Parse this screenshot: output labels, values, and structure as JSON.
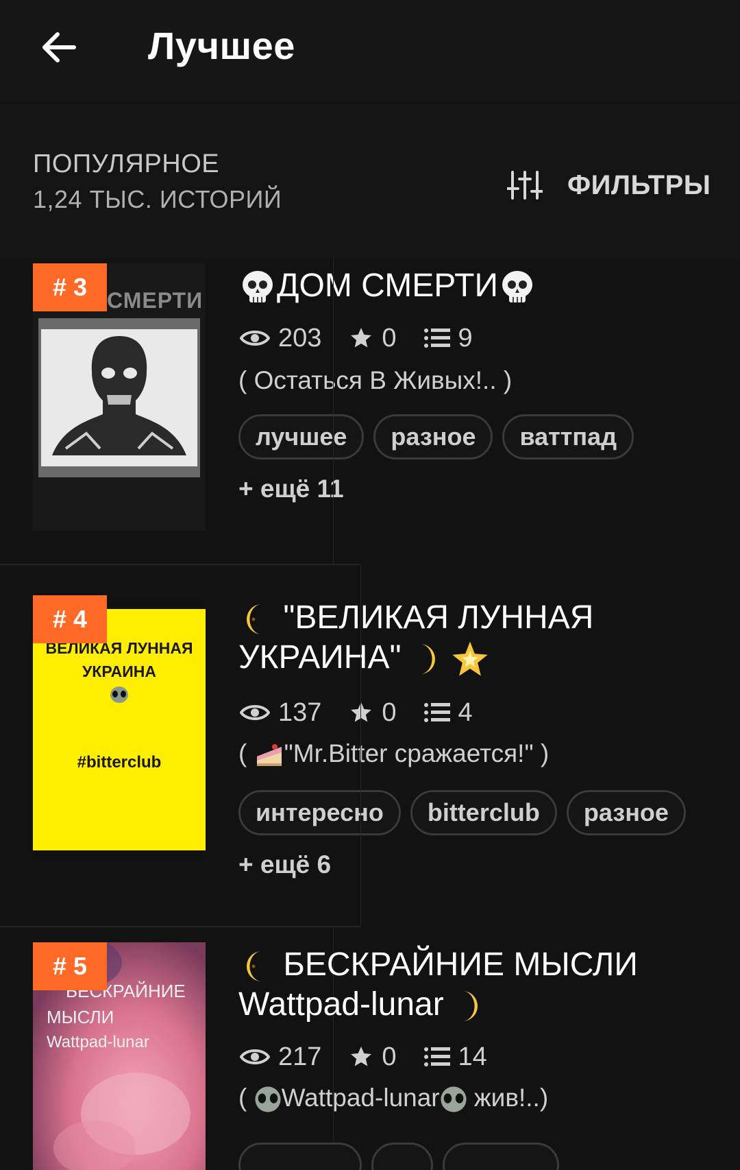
{
  "header": {
    "title": "Лучшее",
    "back_icon": "arrow-left-icon"
  },
  "section": {
    "title": "ПОПУЛЯРНОЕ",
    "count": "1,24 ТЫС. ИСТОРИЙ",
    "filters_label": "ФИЛЬТРЫ",
    "filters_icon": "sliders-icon"
  },
  "stories": [
    {
      "rank": "# 3",
      "title": "ДОМ СМЕРТИ",
      "title_emoji": "skull",
      "cover_text": "СМЕРТИ",
      "views": "203",
      "votes": "0",
      "parts": "9",
      "quote": "(   Остаться В Живых!.. )",
      "tags": [
        "лучшее",
        "разное",
        "ваттпад"
      ],
      "more": "+ ещё 11"
    },
    {
      "rank": "# 4",
      "title_line1": "\"ВЕЛИКАЯ ЛУННАЯ",
      "title_line2": "УКРАИНА\"",
      "cover_line1": "ВЕЛИКАЯ ЛУННАЯ",
      "cover_line2": "УКРАИНА",
      "cover_tag": "#bitterclub",
      "views": "137",
      "votes": "0",
      "parts": "4",
      "quote_pre": "(",
      "quote": "\"Mr.Bitter сражается!\" )",
      "tags": [
        "интересно",
        "bitterclub",
        "разное"
      ],
      "more": "+ ещё 6"
    },
    {
      "rank": "# 5",
      "title_line1": "БЕСКРАЙНИЕ МЫСЛИ",
      "title_line2": "Wattpad-lunar",
      "cover_line1": "БЕСКРАЙНИЕ",
      "cover_line2": "МЫСЛИ",
      "cover_line3": "Wattpad-lunar",
      "views": "217",
      "votes": "0",
      "parts": "14",
      "quote_pre": "(",
      "quote_mid": "Wattpad-lunar",
      "quote_post": " жив!..)"
    }
  ],
  "colors": {
    "accent": "#ff6a26",
    "background": "#121212",
    "cover_yellow": "#ffee00"
  }
}
